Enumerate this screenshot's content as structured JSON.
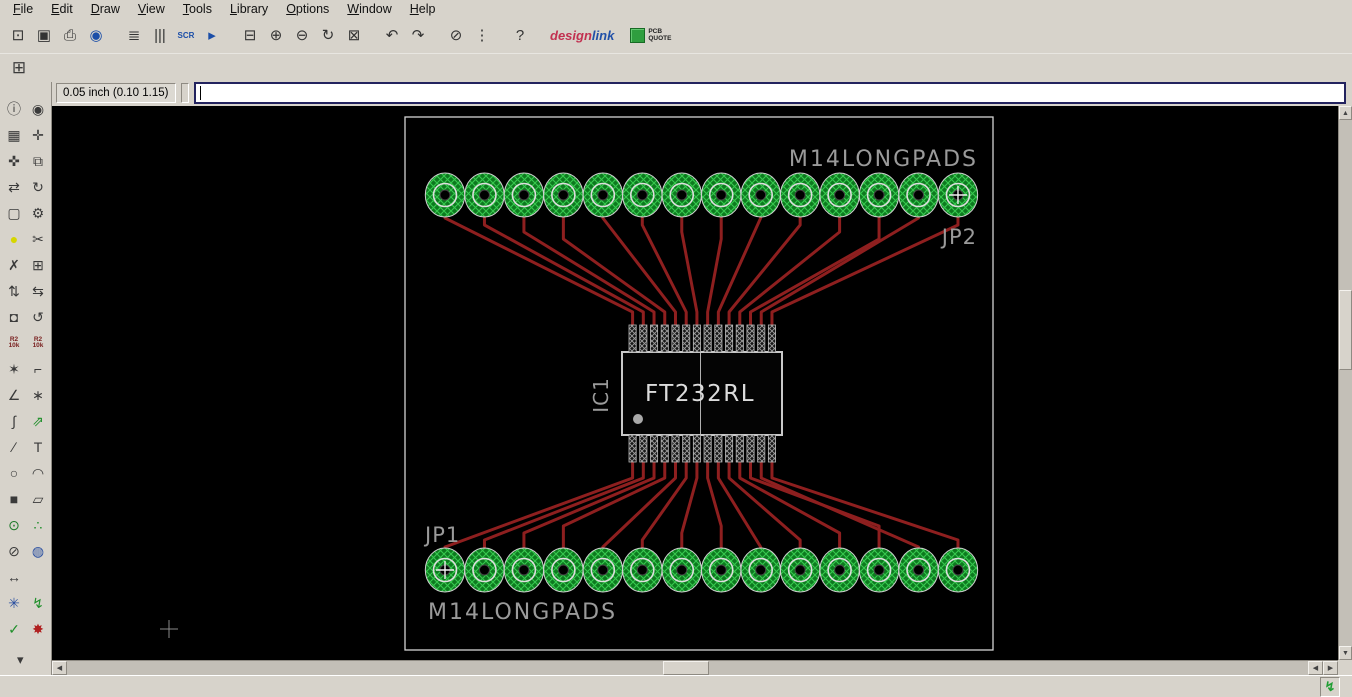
{
  "menu": {
    "items": [
      "File",
      "Edit",
      "Draw",
      "View",
      "Tools",
      "Library",
      "Options",
      "Window",
      "Help"
    ]
  },
  "toolbar": {
    "buttons": [
      {
        "name": "open-button",
        "glyph": "⊡"
      },
      {
        "name": "save-button",
        "glyph": "▣"
      },
      {
        "name": "print-button",
        "glyph": "⎙"
      },
      {
        "name": "cam-processor-button",
        "glyph": "◉",
        "color": "#1b4ea8"
      },
      {
        "sep": true
      },
      {
        "name": "ulp-button",
        "glyph": "≣"
      },
      {
        "name": "layer-settings-button",
        "glyph": "|||"
      },
      {
        "name": "script-button",
        "glyph": "SCR",
        "color": "#1b4ea8",
        "small": true
      },
      {
        "name": "run-button",
        "glyph": "▸",
        "color": "#1b4ea8"
      },
      {
        "sep": true
      },
      {
        "name": "zoom-fit-button",
        "glyph": "⊟"
      },
      {
        "name": "zoom-in-button",
        "glyph": "⊕"
      },
      {
        "name": "zoom-out-button",
        "glyph": "⊖"
      },
      {
        "name": "zoom-redraw-button",
        "glyph": "↻"
      },
      {
        "name": "zoom-select-button",
        "glyph": "⊠"
      },
      {
        "sep": true
      },
      {
        "name": "undo-button",
        "glyph": "↶"
      },
      {
        "name": "redo-button",
        "glyph": "↷"
      },
      {
        "sep": true
      },
      {
        "name": "stop-button",
        "glyph": "⊘"
      },
      {
        "name": "go-button",
        "glyph": "⋮"
      },
      {
        "sep": true
      },
      {
        "name": "help-button",
        "glyph": "?"
      }
    ],
    "brand": {
      "design": "design",
      "link": "link",
      "pcb_quote_line1": "PCB",
      "pcb_quote_line2": "QUOTE"
    }
  },
  "gridbar": {
    "glyph": "⊞"
  },
  "commandbar": {
    "coords": "0.05 inch (0.10 1.15)",
    "command_value": ""
  },
  "palette": {
    "rows": [
      [
        {
          "name": "tool-info",
          "glyph": "ⓘ"
        },
        {
          "name": "tool-show",
          "glyph": "◉"
        }
      ],
      [
        {
          "name": "tool-display",
          "glyph": "▦"
        },
        {
          "name": "tool-mark",
          "glyph": "✛"
        }
      ],
      [
        {
          "name": "tool-move",
          "glyph": "✜"
        },
        {
          "name": "tool-copy",
          "glyph": "⧉"
        }
      ],
      [
        {
          "name": "tool-mirror",
          "glyph": "⇄"
        },
        {
          "name": "tool-rotate",
          "glyph": "↻"
        }
      ],
      [
        {
          "name": "tool-group",
          "glyph": "▢"
        },
        {
          "name": "tool-change",
          "glyph": "⚙"
        }
      ],
      [
        {
          "name": "tool-paste",
          "glyph": "●",
          "color": "#d6d600"
        },
        {
          "name": "tool-cut",
          "glyph": "✂"
        }
      ],
      [
        {
          "name": "tool-delete",
          "glyph": "✗"
        },
        {
          "name": "tool-add",
          "glyph": "⊞"
        }
      ],
      [
        {
          "name": "tool-pinswap",
          "glyph": "⇅"
        },
        {
          "name": "tool-replace",
          "glyph": "⇆"
        }
      ],
      [
        {
          "name": "tool-lock",
          "glyph": "◘"
        },
        {
          "name": "tool-spin",
          "glyph": "↺"
        }
      ],
      [
        {
          "name": "tool-name",
          "glyph": "R2|10k"
        },
        {
          "name": "tool-value",
          "glyph": "R2|10k"
        }
      ],
      [
        {
          "name": "tool-smash",
          "glyph": "✶"
        },
        {
          "name": "tool-miter",
          "glyph": "⌐"
        }
      ],
      [
        {
          "name": "tool-split",
          "glyph": "∠"
        },
        {
          "name": "tool-optimize",
          "glyph": "∗"
        }
      ],
      [
        {
          "name": "tool-route",
          "glyph": "∫"
        },
        {
          "name": "tool-ripup",
          "glyph": "⇗",
          "color": "#1f8f2a"
        }
      ],
      [
        {
          "name": "tool-wire",
          "glyph": "∕"
        },
        {
          "name": "tool-text",
          "glyph": "T"
        }
      ],
      [
        {
          "name": "tool-circle",
          "glyph": "○"
        },
        {
          "name": "tool-arc",
          "glyph": "◠"
        }
      ],
      [
        {
          "name": "tool-rect",
          "glyph": "■"
        },
        {
          "name": "tool-polygon",
          "glyph": "▱"
        }
      ],
      [
        {
          "name": "tool-via",
          "glyph": "⊙",
          "color": "#1f7a2a"
        },
        {
          "name": "tool-signal",
          "glyph": "∴",
          "color": "#1f8f2a"
        }
      ],
      [
        {
          "name": "tool-hole",
          "glyph": "⊘"
        },
        {
          "name": "tool-pad",
          "glyph": "◍",
          "color": "#2a4fa0"
        }
      ],
      [
        {
          "name": "tool-dimension",
          "glyph": "↔"
        },
        null
      ],
      [
        {
          "name": "tool-ratsnest",
          "glyph": "✳",
          "color": "#2a4fa0"
        },
        {
          "name": "tool-auto",
          "glyph": "↯",
          "color": "#1f8f2a"
        }
      ],
      [
        {
          "name": "tool-drc",
          "glyph": "✓",
          "color": "#1f8f2a"
        },
        {
          "name": "tool-errors",
          "glyph": "✸",
          "color": "#b02020"
        }
      ]
    ],
    "scroll_down_glyph": "▾"
  },
  "scrollbars": {
    "left": "◀",
    "right": "▶",
    "up": "▲",
    "down": "▼"
  },
  "statusbar": {
    "icon_glyph": "↯"
  },
  "pcb": {
    "labels": {
      "top_library": "M14LONGPADS",
      "top_ref": "JP2",
      "bottom_ref": "JP1",
      "bottom_library": "M14LONGPADS",
      "ic_ref": "IC1",
      "ic_value": "FT232RL"
    },
    "top_header_pins": 14,
    "bottom_header_pins": 14,
    "ic_pins_per_side": 14,
    "colors": {
      "trace": "#8e1f1f",
      "pad_fill": "#0d7a1f",
      "pad_hatch": "#37c94f",
      "silk": "#9a9a9a",
      "ic_text": "#dcdcdc",
      "outline": "#d4d4d4"
    }
  }
}
